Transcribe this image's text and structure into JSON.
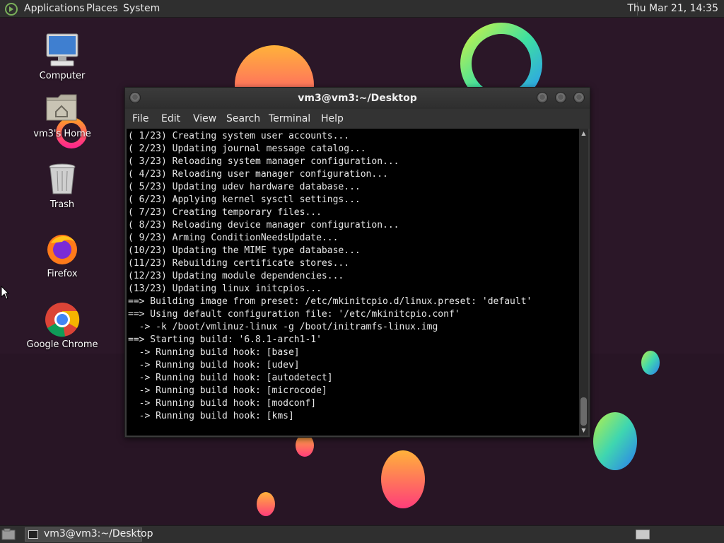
{
  "top_panel": {
    "menus": [
      "Applications",
      "Places",
      "System"
    ],
    "clock": "Thu Mar 21, 14:35"
  },
  "desktop_icons": [
    {
      "label": "Computer",
      "icon": "computer-icon"
    },
    {
      "label": "vm3's Home",
      "icon": "home-folder-icon"
    },
    {
      "label": "Trash",
      "icon": "trash-icon"
    },
    {
      "label": "Firefox",
      "icon": "firefox-icon"
    },
    {
      "label": "Google Chrome",
      "icon": "chrome-icon"
    }
  ],
  "window": {
    "title": "vm3@vm3:~/Desktop",
    "menus": [
      "File",
      "Edit",
      "View",
      "Search",
      "Terminal",
      "Help"
    ],
    "lines": [
      "( 1/23) Creating system user accounts...",
      "( 2/23) Updating journal message catalog...",
      "( 3/23) Reloading system manager configuration...",
      "( 4/23) Reloading user manager configuration...",
      "( 5/23) Updating udev hardware database...",
      "( 6/23) Applying kernel sysctl settings...",
      "( 7/23) Creating temporary files...",
      "( 8/23) Reloading device manager configuration...",
      "( 9/23) Arming ConditionNeedsUpdate...",
      "(10/23) Updating the MIME type database...",
      "(11/23) Rebuilding certificate stores...",
      "(12/23) Updating module dependencies...",
      "(13/23) Updating linux initcpios...",
      "==> Building image from preset: /etc/mkinitcpio.d/linux.preset: 'default'",
      "==> Using default configuration file: '/etc/mkinitcpio.conf'",
      "  -> -k /boot/vmlinuz-linux -g /boot/initramfs-linux.img",
      "==> Starting build: '6.8.1-arch1-1'",
      "  -> Running build hook: [base]",
      "  -> Running build hook: [udev]",
      "  -> Running build hook: [autodetect]",
      "  -> Running build hook: [microcode]",
      "  -> Running build hook: [modconf]",
      "  -> Running build hook: [kms]"
    ]
  },
  "taskbar": {
    "task_label": "vm3@vm3:~/Desktop"
  }
}
